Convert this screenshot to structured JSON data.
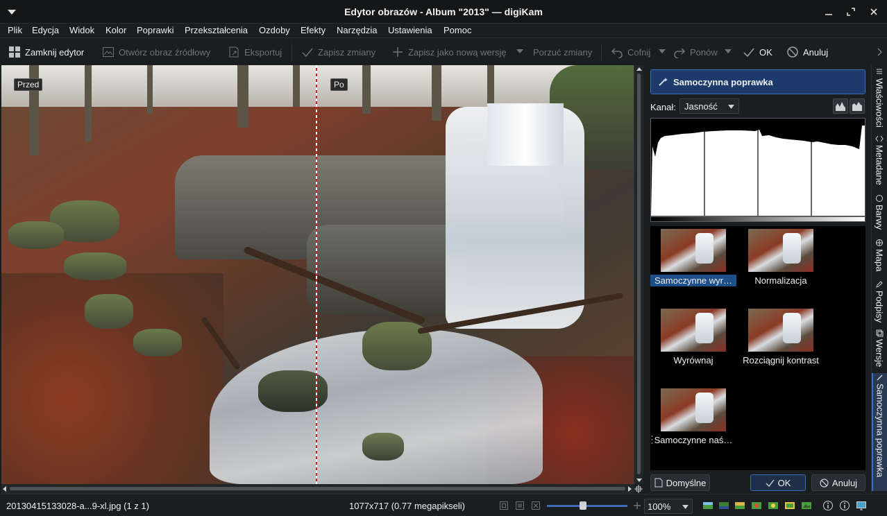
{
  "window": {
    "title": "Edytor obrazów - Album \"2013\" — digiKam"
  },
  "menu": [
    "Plik",
    "Edycja",
    "Widok",
    "Kolor",
    "Poprawki",
    "Przekształcenia",
    "Ozdoby",
    "Efekty",
    "Narzędzia",
    "Ustawienia",
    "Pomoc"
  ],
  "toolbar": {
    "close_editor": "Zamknij edytor",
    "open_original": "Otwórz obraz źródłowy",
    "export": "Eksportuj",
    "save_changes": "Zapisz zmiany",
    "save_new_version": "Zapisz jako nową wersję",
    "discard": "Porzuć zmiany",
    "undo": "Cofnij",
    "redo": "Ponów",
    "ok": "OK",
    "cancel": "Anuluj"
  },
  "canvas": {
    "before_label": "Przed",
    "after_label": "Po"
  },
  "panel": {
    "title": "Samoczynna poprawka",
    "channel_label": "Kanał:",
    "channel_value": "Jasność",
    "presets": [
      {
        "label": "Samoczynne wyr…",
        "selected": true
      },
      {
        "label": "Normalizacja",
        "selected": false
      },
      {
        "label": "Wyrównaj",
        "selected": false
      },
      {
        "label": "Rozciągnij kontrast",
        "selected": false
      },
      {
        "label": "Samoczynne naś…",
        "selected": false
      }
    ],
    "defaults_button": "Domyślne",
    "ok_button": "OK",
    "cancel_button": "Anuluj"
  },
  "sidetabs": [
    "Właściwości",
    "Metadane",
    "Barwy",
    "Mapa",
    "Podpisy",
    "Wersje",
    "Samoczynna poprawka"
  ],
  "status": {
    "filename": "20130415133028-a...9-xl.jpg (1 z 1)",
    "dimensions": "1077x717 (0.77 megapikseli)",
    "zoom": "100%",
    "zoom_slider_fraction": 0.45
  },
  "colors": {
    "accent": "#3d6fb8",
    "background": "#1b1e20",
    "selection": "#1d4f8a"
  }
}
